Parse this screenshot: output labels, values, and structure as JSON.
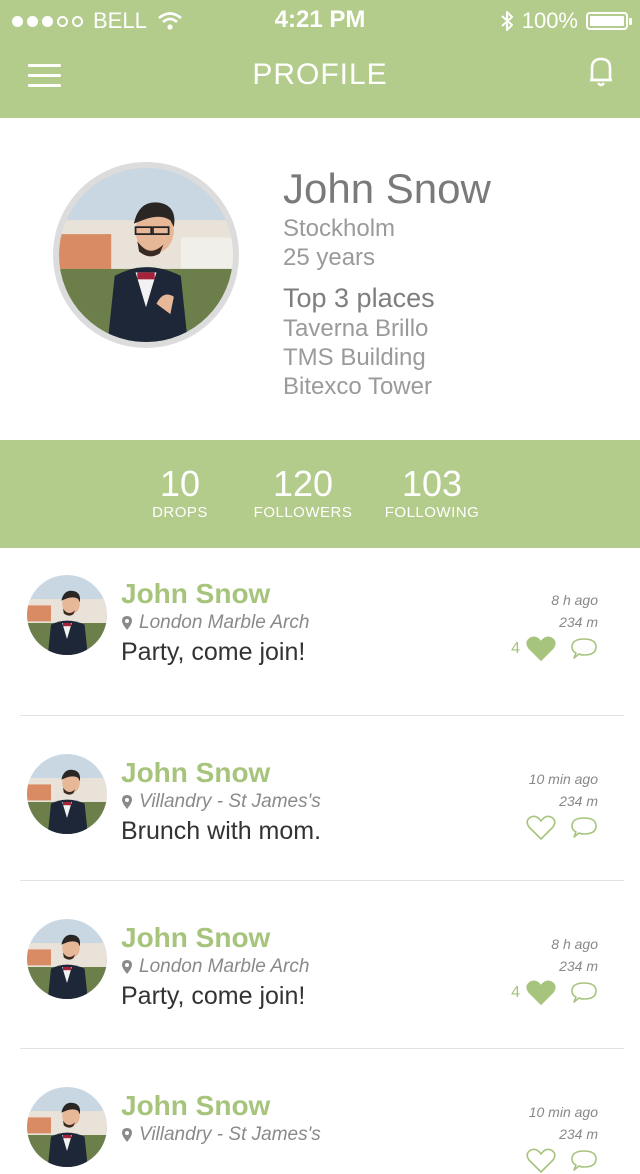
{
  "status": {
    "carrier": "BELL",
    "time": "4:21 PM",
    "battery": "100%"
  },
  "nav": {
    "title": "PROFILE"
  },
  "profile": {
    "name": "John Snow",
    "city": "Stockholm",
    "age": "25 years",
    "top_places_title": "Top 3 places",
    "places": [
      "Taverna Brillo",
      "TMS Building",
      "Bitexco Tower"
    ]
  },
  "stats": [
    {
      "value": "10",
      "label": "DROPS"
    },
    {
      "value": "120",
      "label": "FOLLOWERS"
    },
    {
      "value": "103",
      "label": "FOLLOWING"
    }
  ],
  "posts": [
    {
      "name": "John Snow",
      "location": "London Marble Arch",
      "message": "Party, come join!",
      "time": "8 h ago",
      "distance": "234 m",
      "likes": "4",
      "liked": true
    },
    {
      "name": "John Snow",
      "location": "Villandry - St James's",
      "message": "Brunch with mom.",
      "time": "10 min ago",
      "distance": "234 m",
      "likes": "",
      "liked": false
    },
    {
      "name": "John Snow",
      "location": "London Marble Arch",
      "message": "Party, come join!",
      "time": "8 h ago",
      "distance": "234 m",
      "likes": "4",
      "liked": true
    },
    {
      "name": "John Snow",
      "location": "Villandry - St James's",
      "message": "",
      "time": "10 min ago",
      "distance": "234 m",
      "likes": "",
      "liked": false
    }
  ],
  "colors": {
    "accent": "#b3cc8b",
    "accent_text": "#a7c47c"
  }
}
